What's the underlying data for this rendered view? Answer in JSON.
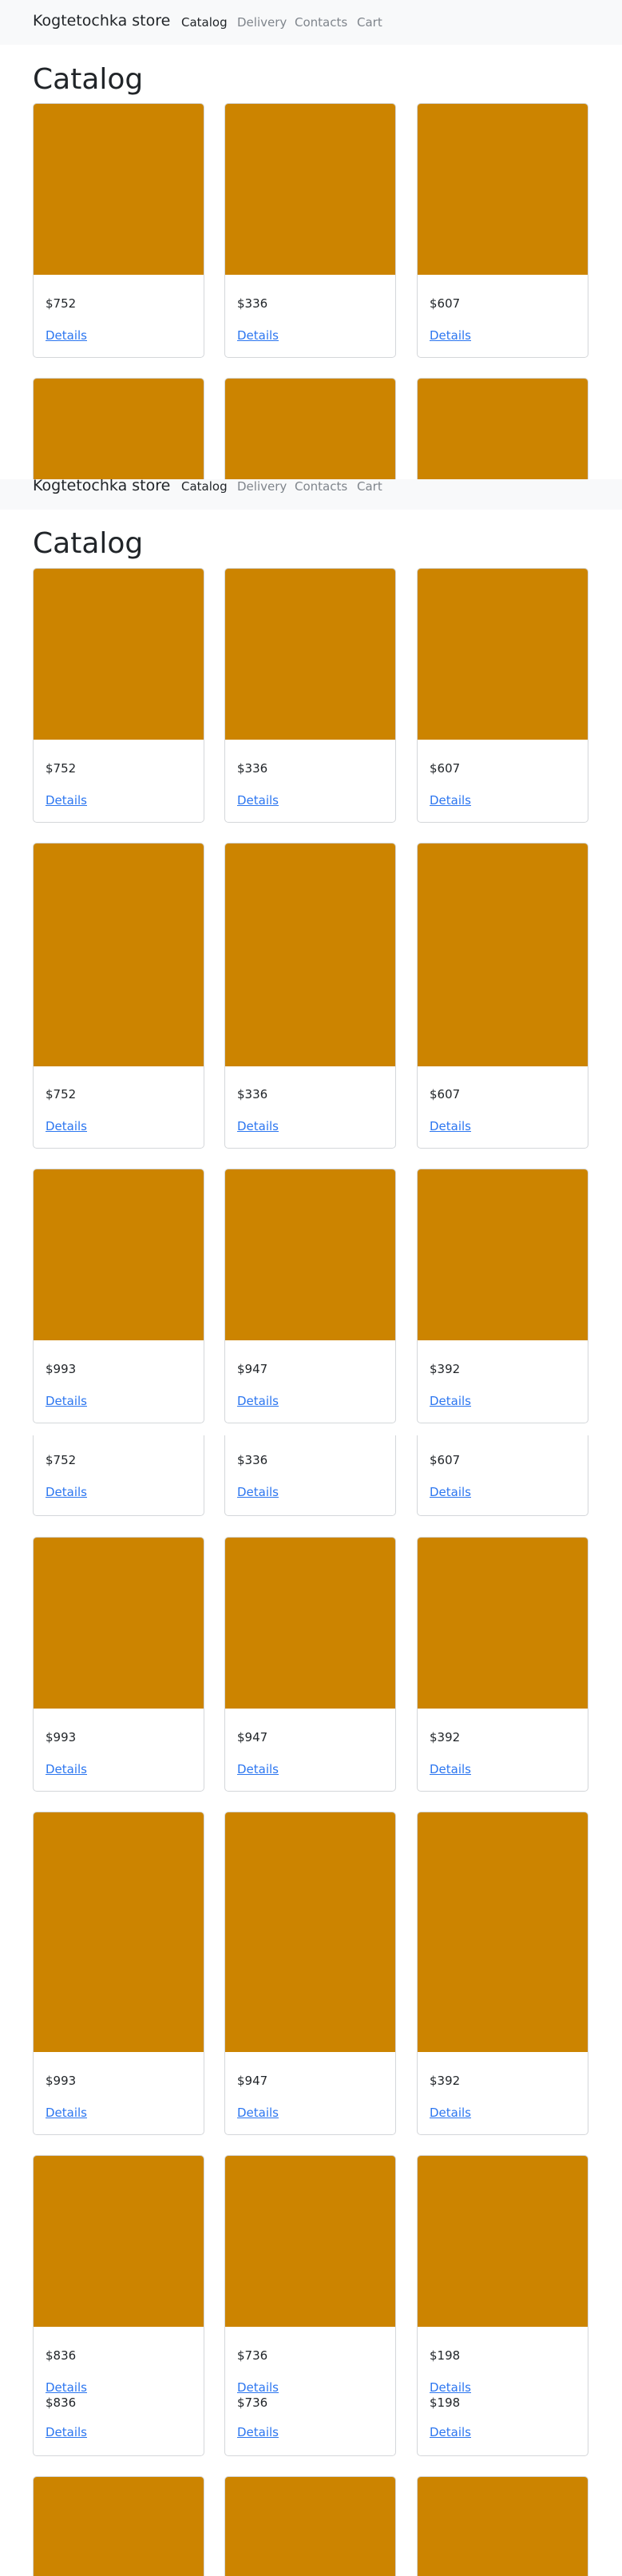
{
  "brand": "Kogtetochka store",
  "nav": [
    "Catalog",
    "Delivery",
    "Contacts",
    "Cart"
  ],
  "title": "Catalog",
  "details_label": "Details",
  "prices": {
    "a": [
      "$752",
      "$336",
      "$607"
    ],
    "b": [
      "$993",
      "$947",
      "$392"
    ],
    "c": [
      "$836",
      "$736",
      "$198"
    ]
  },
  "colors": {
    "product_image": "#cc8400",
    "navbar_bg": "#f8f9fa",
    "link": "#2c76f0",
    "nav_muted": "#7f858c"
  }
}
